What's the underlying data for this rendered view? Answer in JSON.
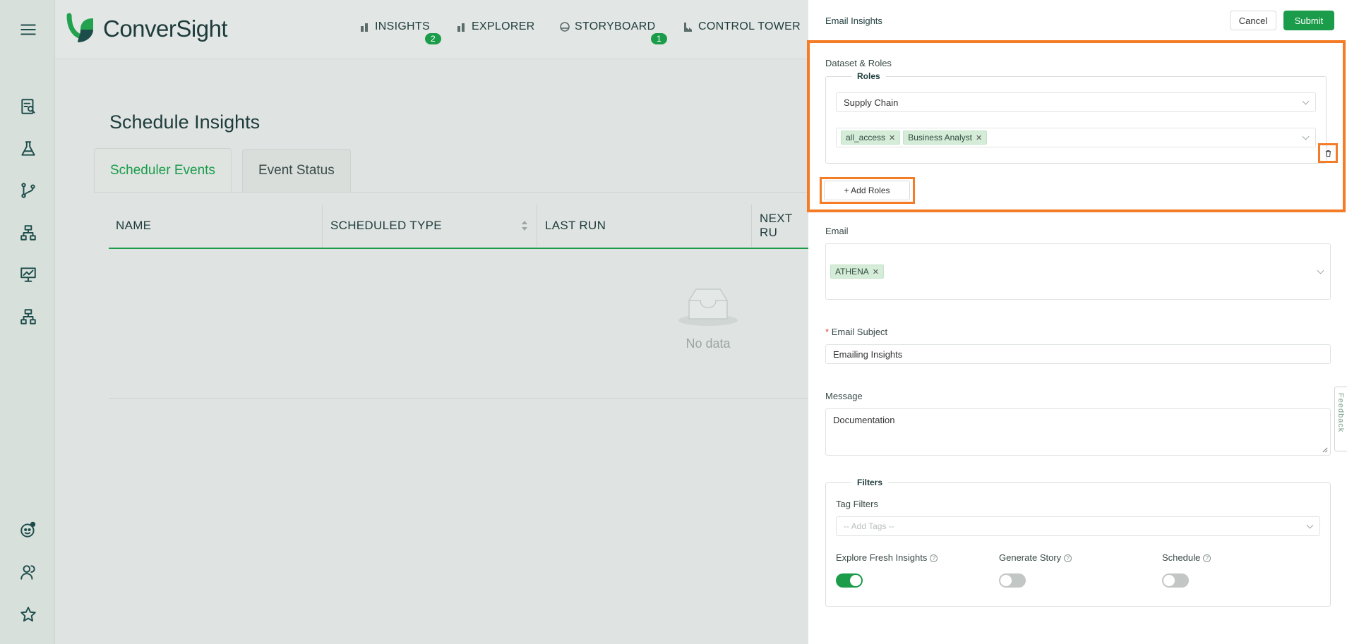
{
  "brand": {
    "name": "ConverSight"
  },
  "nav": {
    "insights": {
      "label": "INSIGHTS",
      "badge": "2"
    },
    "explorer": {
      "label": "EXPLORER"
    },
    "storyboard": {
      "label": "STORYBOARD",
      "badge": "1"
    },
    "control_tower": {
      "label": "CONTROL TOWER"
    }
  },
  "sidebar": {
    "icons": [
      "menu-icon",
      "insights-report-icon",
      "flask-icon",
      "branch-icon",
      "hierarchy-icon",
      "presentation-chart-icon",
      "org-chart-icon",
      "bot-icon",
      "users-icon",
      "star-icon"
    ]
  },
  "main": {
    "title": "Schedule Insights",
    "tabs": [
      {
        "label": "Scheduler Events",
        "active": true
      },
      {
        "label": "Event Status",
        "active": false
      }
    ],
    "columns": [
      "NAME",
      "SCHEDULED TYPE",
      "LAST RUN",
      "NEXT RU"
    ],
    "empty_text": "No data"
  },
  "drawer": {
    "title": "Email Insights",
    "cancel_label": "Cancel",
    "submit_label": "Submit",
    "dataset_roles": {
      "label": "Dataset & Roles",
      "legend": "Roles",
      "dataset": "Supply Chain",
      "roles": [
        "all_access",
        "Business Analyst"
      ],
      "add_roles_label": "+ Add Roles"
    },
    "email": {
      "label": "Email",
      "recipients": [
        "ATHENA"
      ]
    },
    "subject": {
      "required_mark": "*",
      "label": "Email Subject",
      "value": "Emailing Insights"
    },
    "message": {
      "label": "Message",
      "value": "Documentation"
    },
    "filters": {
      "legend": "Filters",
      "tag_label": "Tag Filters",
      "tag_placeholder": "-- Add Tags --",
      "toggles": [
        {
          "label": "Explore Fresh Insights",
          "on": true
        },
        {
          "label": "Generate Story",
          "on": false
        },
        {
          "label": "Schedule",
          "on": false
        }
      ]
    },
    "feedback_label": "Feedback"
  },
  "colors": {
    "accent": "#1a9c4a",
    "highlight": "#f47c27"
  }
}
